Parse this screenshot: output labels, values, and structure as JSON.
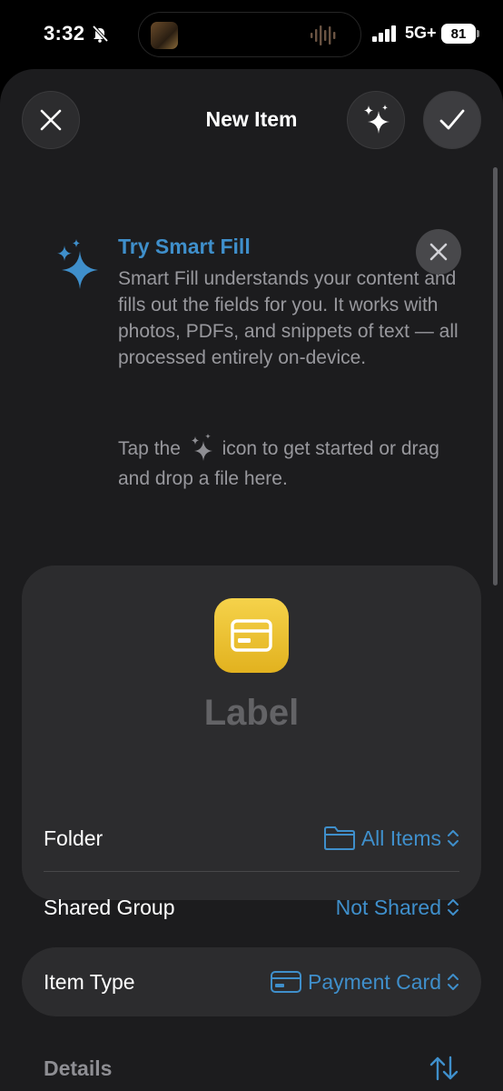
{
  "status_bar": {
    "time": "3:32",
    "network": "5G+",
    "battery": "81"
  },
  "nav": {
    "title": "New Item"
  },
  "smart_fill": {
    "title": "Try Smart Fill",
    "body": "Smart Fill understands your content and fills out the fields for you. It works with photos, PDFs, and snippets of text — all processed entirely on-device.",
    "tap_before": "Tap the",
    "tap_after": "icon to get started or drag and drop a file here."
  },
  "item": {
    "label": "Label",
    "folder_label": "Folder",
    "folder_value": "All Items",
    "shared_label": "Shared Group",
    "shared_value": "Not Shared"
  },
  "item_type": {
    "label": "Item Type",
    "value": "Payment Card"
  },
  "details": {
    "heading": "Details"
  },
  "colors": {
    "accent": "#3f8fcb",
    "card_icon": "#f0c832",
    "sheet_bg": "#1c1c1e",
    "card_bg": "#2c2c2e"
  },
  "icons": [
    "bell-slash-icon",
    "signal-icon",
    "close-icon",
    "sparkles-icon",
    "checkmark-icon",
    "credit-card-icon",
    "folder-icon",
    "chevron-updown-icon",
    "sort-arrows-icon"
  ]
}
